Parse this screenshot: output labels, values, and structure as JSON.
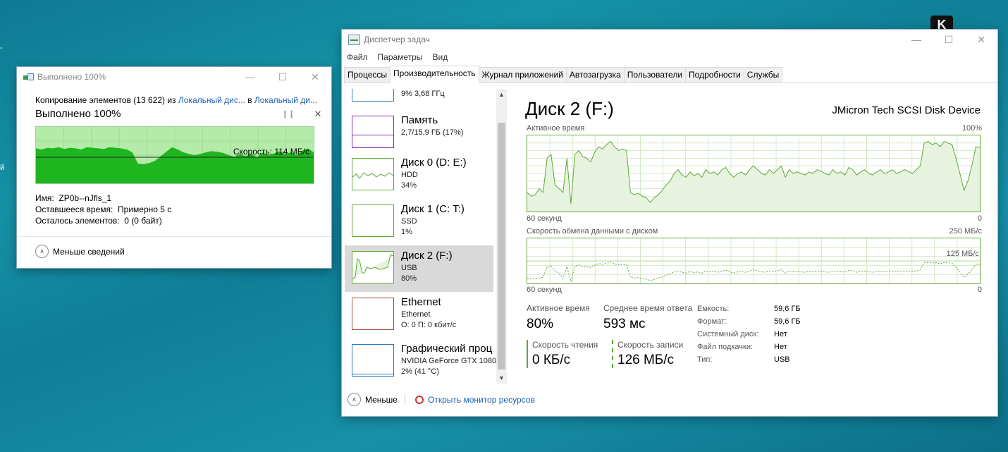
{
  "desktop": {
    "badge": "K"
  },
  "copy_dialog": {
    "title": "Выполнено 100%",
    "line_prefix": "Копирование элементов (13 622) из ",
    "source": "Локальный дис...",
    "line_mid": " в ",
    "dest": "Локальный ди...",
    "progress_text": "Выполнено 100%",
    "speed": "Скорость: 114 МБ/с",
    "name_label": "Имя:",
    "name_value": "ZP0b--nJfls_1",
    "remaining_time_label": "Оставшееся время:",
    "remaining_time_value": "Примерно 5 с",
    "remaining_items_label": "Осталось элементов:",
    "remaining_items_value": "0 (0 байт)",
    "less_details": "Меньше сведений",
    "progress_fraction": 1.0,
    "speed_history": [
      0.62,
      0.6,
      0.63,
      0.62,
      0.64,
      0.61,
      0.63,
      0.62,
      0.6,
      0.64,
      0.63,
      0.62,
      0.61,
      0.64,
      0.63,
      0.62,
      0.6,
      0.55,
      0.35,
      0.34,
      0.36,
      0.4,
      0.48,
      0.56,
      0.64,
      0.6,
      0.55,
      0.52,
      0.5,
      0.52,
      0.55,
      0.57,
      0.56,
      0.54,
      0.5,
      0.47,
      0.52,
      0.48,
      0.53,
      0.46,
      0.55,
      0.5,
      0.53,
      0.57,
      0.52,
      0.55,
      0.5,
      0.58,
      0.62,
      0.55
    ]
  },
  "taskmgr": {
    "title": "Диспетчер задач",
    "menu": [
      "Файл",
      "Параметры",
      "Вид"
    ],
    "tabs": [
      "Процессы",
      "Производительность",
      "Журнал приложений",
      "Автозагрузка",
      "Пользователи",
      "Подробности",
      "Службы"
    ],
    "sidebar": [
      {
        "name": "",
        "line1": "9% 3,68 ГГц",
        "line2": ""
      },
      {
        "name": "Память",
        "line1": "2,7/15,9 ГБ (17%)",
        "line2": ""
      },
      {
        "name": "Диск 0 (D: E:)",
        "line1": "HDD",
        "line2": "34%"
      },
      {
        "name": "Диск 1 (C: T:)",
        "line1": "SSD",
        "line2": "1%"
      },
      {
        "name": "Диск 2 (F:)",
        "line1": "USB",
        "line2": "80%"
      },
      {
        "name": "Ethernet",
        "line1": "Ethernet",
        "line2": "О: 0 П: 0 кбит/с"
      },
      {
        "name": "Графический проц",
        "line1": "NVIDIA GeForce GTX 1080",
        "line2": "2%  (41 °C)"
      }
    ],
    "disk": {
      "title": "Диск 2 (F:)",
      "model": "JMicron Tech SCSI Disk Device",
      "active_label": "Активное время",
      "active_max": "100%",
      "sixty_sec": "60 секунд",
      "zero": "0",
      "transfer_label": "Скорость обмена данными с диском",
      "transfer_max": "250 МБ/с",
      "transfer_mid": "125 МБ/с",
      "stats": {
        "active_time_label": "Активное время",
        "active_time_value": "80%",
        "avg_response_label": "Среднее время ответа",
        "avg_response_value": "593 мс",
        "read_label": "Скорость чтения",
        "read_value": "0 КБ/с",
        "write_label": "Скорость записи",
        "write_value": "126 МБ/с"
      },
      "properties": [
        {
          "k": "Емкость:",
          "v": "59,6 ГБ"
        },
        {
          "k": "Формат:",
          "v": "59,6 ГБ"
        },
        {
          "k": "Системный диск:",
          "v": "Нет"
        },
        {
          "k": "Файл подкачки:",
          "v": "Нет"
        },
        {
          "k": "Тип:",
          "v": "USB"
        }
      ],
      "active_history": [
        25,
        20,
        22,
        30,
        25,
        70,
        75,
        35,
        30,
        25,
        70,
        10,
        75,
        80,
        72,
        70,
        65,
        78,
        85,
        82,
        88,
        92,
        85,
        80,
        82,
        80,
        25,
        22,
        24,
        20,
        18,
        12,
        18,
        22,
        28,
        35,
        40,
        50,
        55,
        48,
        45,
        52,
        47,
        50,
        45,
        55,
        50,
        52,
        48,
        55,
        58,
        50,
        45,
        50,
        52,
        48,
        55,
        60,
        55,
        50,
        48,
        55,
        50,
        55,
        60,
        45,
        55,
        50,
        52,
        50,
        48,
        52,
        50,
        55,
        53,
        50,
        48,
        55,
        50,
        52,
        48,
        58,
        55,
        48,
        52,
        55,
        50,
        48,
        52,
        55,
        50,
        52,
        55,
        50,
        52,
        55,
        53,
        50,
        55,
        60,
        90,
        92,
        88,
        90,
        85,
        92,
        90,
        88,
        70,
        50,
        28,
        40,
        60,
        85,
        84
      ],
      "write_history": [
        12,
        11,
        12,
        13,
        15,
        40,
        42,
        30,
        25,
        12,
        40,
        5,
        42,
        45,
        40,
        41,
        38,
        44,
        48,
        46,
        50,
        52,
        47,
        45,
        46,
        45,
        15,
        13,
        14,
        12,
        10,
        7,
        10,
        13,
        16,
        20,
        23,
        28,
        30,
        27,
        25,
        29,
        26,
        28,
        25,
        30,
        28,
        29,
        27,
        30,
        32,
        28,
        25,
        28,
        29,
        27,
        30,
        33,
        30,
        28,
        27,
        30,
        28,
        30,
        33,
        25,
        30,
        28,
        29,
        28,
        27,
        29,
        28,
        30,
        29,
        28,
        27,
        30,
        28,
        29,
        27,
        32,
        30,
        27,
        29,
        30,
        28,
        27,
        29,
        30,
        28,
        29,
        30,
        28,
        29,
        30,
        29,
        28,
        30,
        33,
        50,
        51,
        49,
        50,
        47,
        51,
        50,
        49,
        39,
        28,
        15,
        22,
        33,
        47,
        46
      ]
    },
    "footer": {
      "less": "Меньше",
      "monitor": "Открыть монитор ресурсов"
    }
  },
  "colors": {
    "disk_green": "#5fa83a",
    "copy_green": "#1fb51f",
    "memory_purple": "#8b2fa8",
    "network_brown": "#a0522d",
    "gpu_blue": "#2f7bbf",
    "cpu_blue": "#2f7bbf",
    "selection": "#d9d9d9"
  }
}
